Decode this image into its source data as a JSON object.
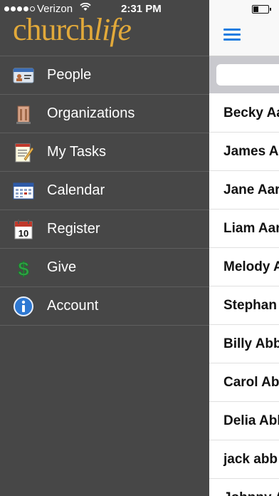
{
  "status_bar": {
    "carrier": "Verizon",
    "time": "2:31 PM",
    "signal_bars": 4,
    "signal_total": 5
  },
  "app": {
    "logo_church": "church",
    "logo_life": "life",
    "brand_color": "#e2a93a"
  },
  "menu": {
    "items": [
      {
        "label": "People",
        "icon": "people-card-icon"
      },
      {
        "label": "Organizations",
        "icon": "building-icon"
      },
      {
        "label": "My Tasks",
        "icon": "notepad-icon"
      },
      {
        "label": "Calendar",
        "icon": "calendar-icon"
      },
      {
        "label": "Register",
        "icon": "date-10-icon"
      },
      {
        "label": "Give",
        "icon": "dollar-icon"
      },
      {
        "label": "Account",
        "icon": "info-icon"
      }
    ]
  },
  "search": {
    "placeholder": ""
  },
  "people": [
    "Becky Aa",
    "James A",
    "Jane Aar",
    "Liam Aar",
    "Melody A",
    "Stephan",
    "Billy Abb",
    "Carol Ab",
    "Delia Abb",
    "jack abb",
    "Johnny A"
  ],
  "colors": {
    "accent": "#1e7de0",
    "menu_bg": "#474747"
  }
}
